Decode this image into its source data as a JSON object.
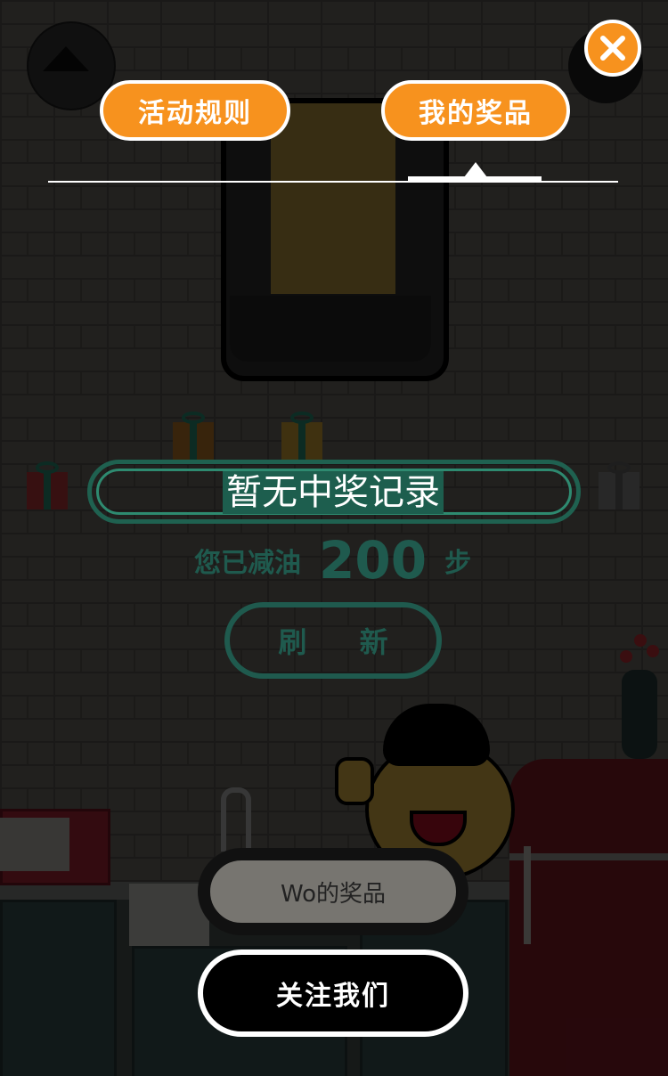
{
  "tabs": {
    "rules_label": "活动规则",
    "prizes_label": "我的奖品",
    "active": "prizes"
  },
  "message": {
    "no_records": "暂无中奖记录"
  },
  "steps": {
    "prefix": "您已减油",
    "value": "200",
    "suffix": "步"
  },
  "buttons": {
    "refresh": "刷 新",
    "wo_prizes": "Wo的奖品",
    "follow": "关注我们"
  },
  "icons": {
    "close": "close-icon",
    "avatar": "avatar-icon"
  },
  "colors": {
    "accent": "#f7921e",
    "teal": "#1f5a4e",
    "white": "#ffffff"
  }
}
